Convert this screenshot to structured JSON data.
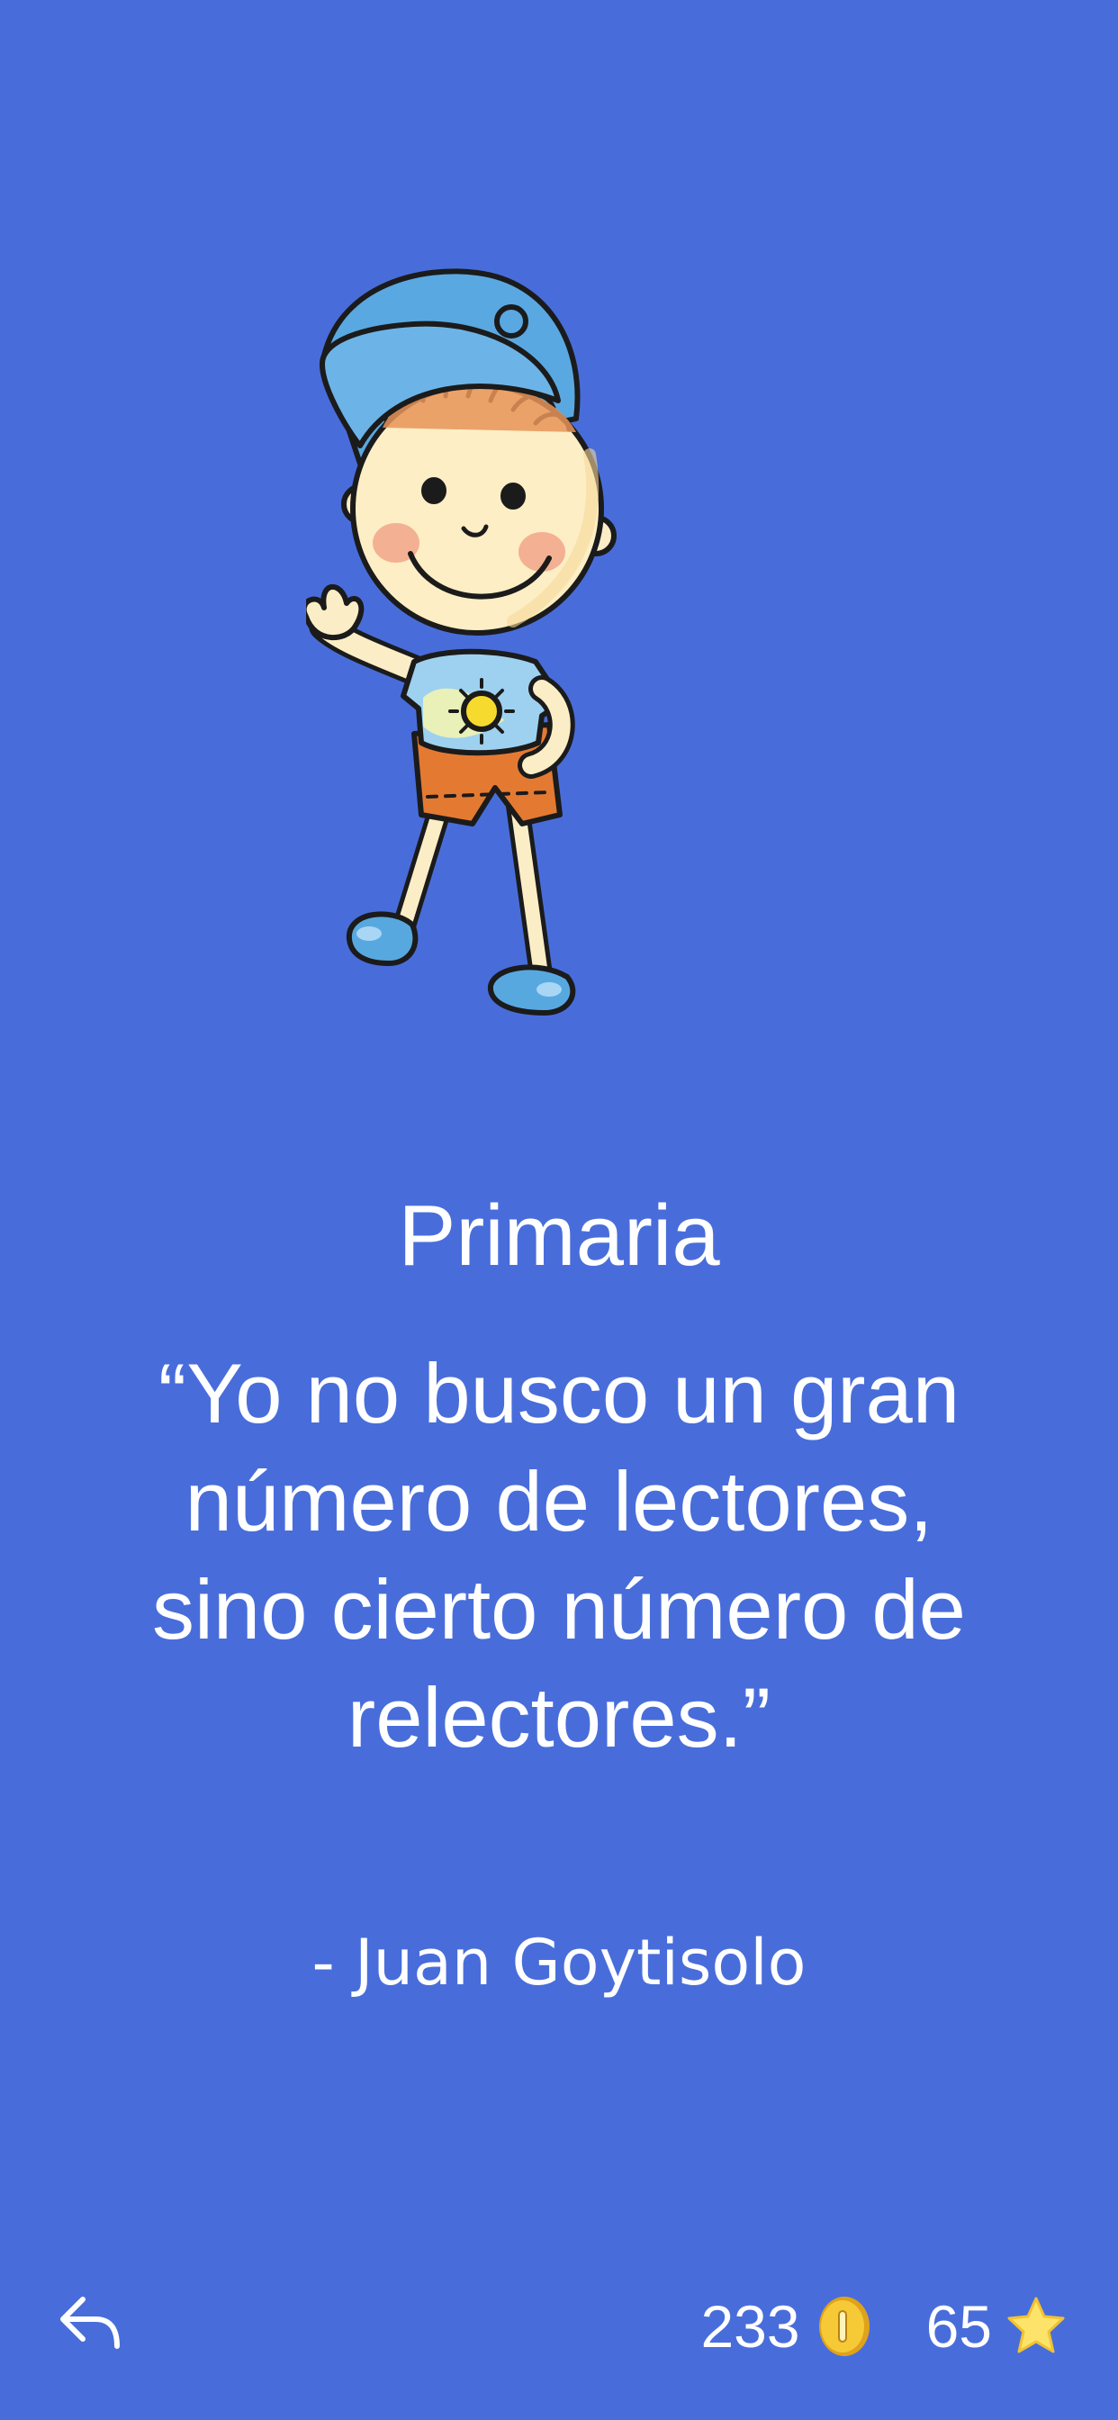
{
  "level": {
    "title": "Primaria"
  },
  "quote": {
    "text": "“Yo no busco un gran número de lectores, sino cierto número de relectores.”",
    "author": "- Juan Goytisolo"
  },
  "stats": {
    "coins": "233",
    "stars": "65"
  },
  "icons": {
    "back": "reply-arrow-icon",
    "coin": "gold-coin-icon",
    "star": "star-icon"
  },
  "colors": {
    "background": "#486ddb",
    "text": "#ffffff",
    "coin": "#f2c230",
    "star": "#fde36a"
  }
}
